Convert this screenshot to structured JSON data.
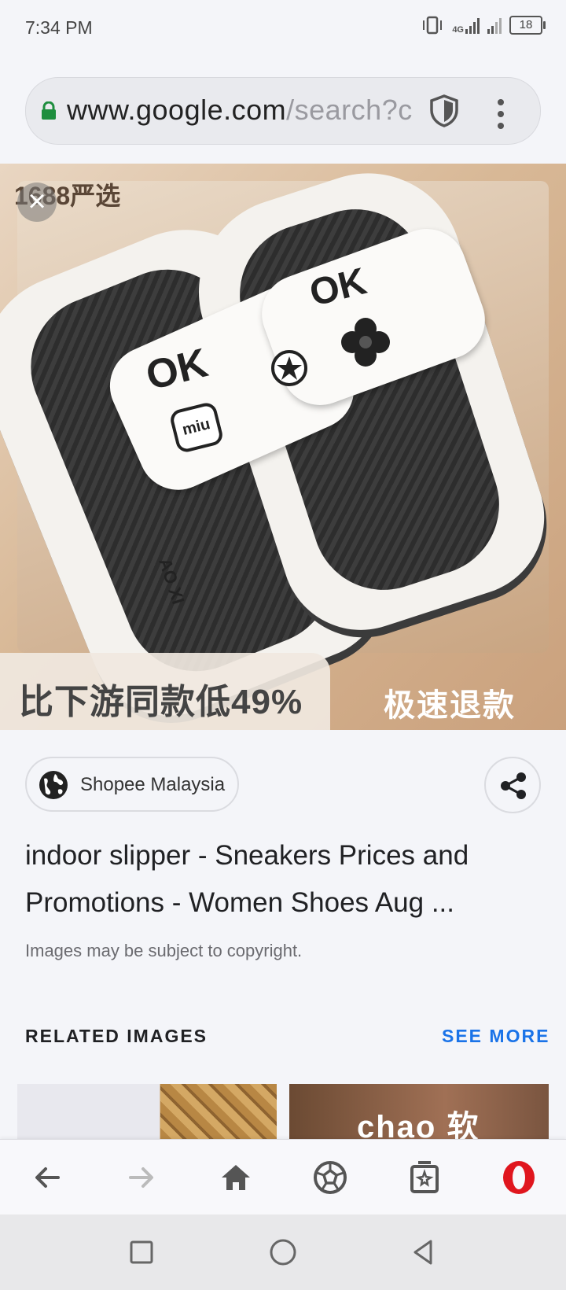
{
  "status_bar": {
    "time": "7:34 PM",
    "network_type": "4G",
    "battery_level": "18"
  },
  "browser": {
    "url_domain": "www.google.com",
    "url_path": "/search?c",
    "icons": [
      "lock-icon",
      "shield-icon",
      "more-vert-icon"
    ]
  },
  "image": {
    "watermark": "1688严选",
    "caption_left": "比下游同款低49%",
    "caption_right": "极速退款",
    "charms": {
      "ok": "OK",
      "miu": "miu",
      "brand": "AO XI"
    }
  },
  "source": {
    "site_name": "Shopee Malaysia"
  },
  "result": {
    "title": "indoor slipper - Sneakers Prices and Promotions - Women Shoes Aug ...",
    "copyright_note": "Images may be subject to copyright."
  },
  "related": {
    "heading": "RELATED IMAGES",
    "see_more": "SEE MORE",
    "thumb_2_text": "chao 软"
  },
  "bottom_nav": {
    "items": [
      "back-arrow-icon",
      "forward-arrow-icon",
      "home-icon",
      "soccer-ball-icon",
      "tabs-icon",
      "opera-icon"
    ]
  },
  "colors": {
    "accent_link": "#1a73e8",
    "opera_red": "#e0161e",
    "lock_green": "#1e8e3e"
  }
}
